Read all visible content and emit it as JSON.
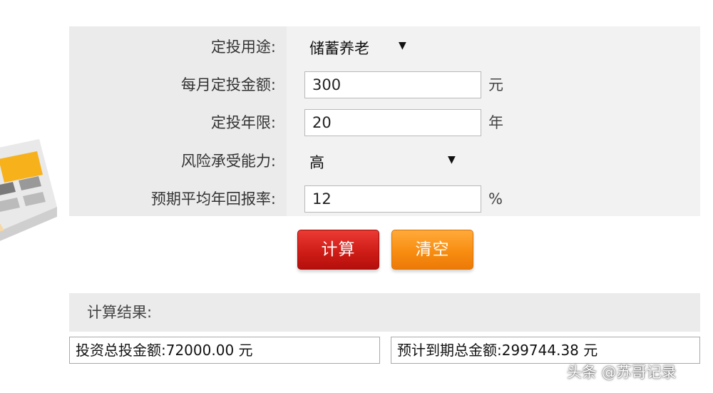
{
  "form": {
    "purpose": {
      "label": "定投用途:",
      "value": "储蓄养老"
    },
    "monthly_amount": {
      "label": "每月定投金额:",
      "value": "300",
      "unit": "元"
    },
    "years": {
      "label": "定投年限:",
      "value": "20",
      "unit": "年"
    },
    "risk": {
      "label": "风险承受能力:",
      "value": "高"
    },
    "return_rate": {
      "label": "预期平均年回报率:",
      "value": "12",
      "unit": "%"
    }
  },
  "buttons": {
    "calculate": "计算",
    "clear": "清空"
  },
  "result": {
    "title": "计算结果:",
    "total_invested": "投资总投金额:72000.00 元",
    "total_maturity": "预计到期总金额:299744.38 元"
  },
  "watermark": "头条 @苏哥记录",
  "icons": {
    "dropdown": "triangle-down-icon",
    "calculator": "calculator-icon"
  },
  "colors": {
    "calculate_button": "#d1201a",
    "clear_button": "#f98f12",
    "panel_bg": "#f2f2f2",
    "label_bg": "#ebebeb"
  }
}
